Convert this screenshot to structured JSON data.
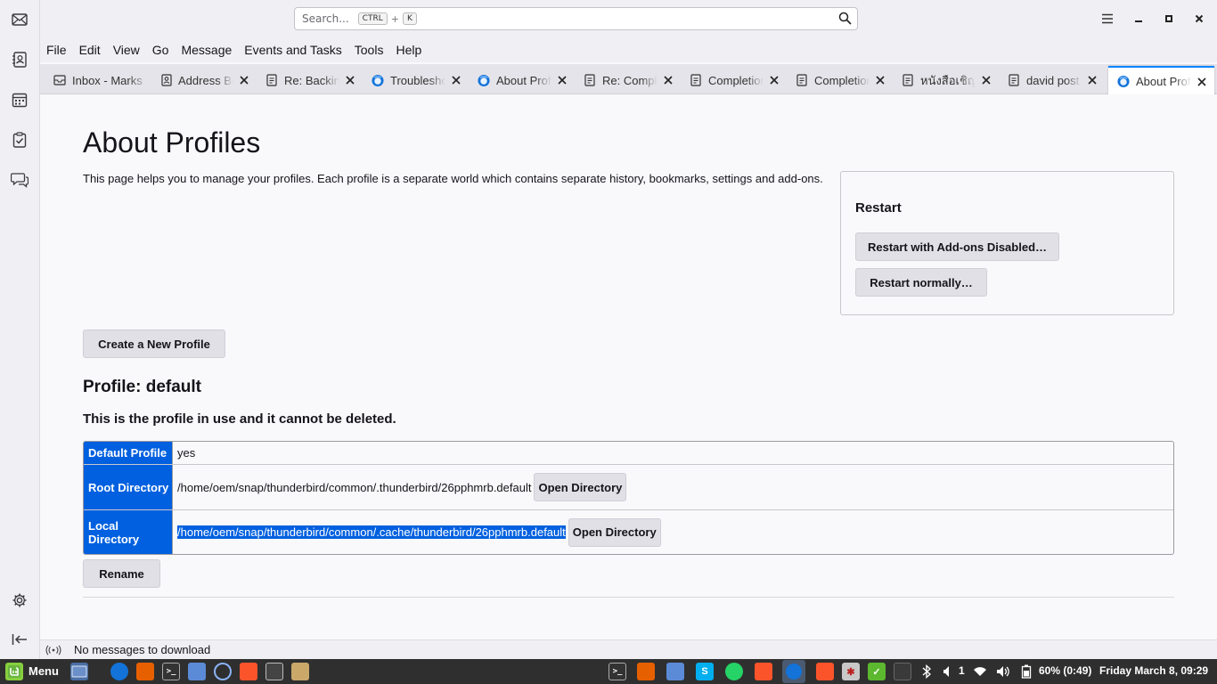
{
  "search": {
    "placeholder": "Search...",
    "shortcut_mod": "CTRL",
    "shortcut_plus": "+",
    "shortcut_key": "K"
  },
  "menubar": [
    "File",
    "Edit",
    "View",
    "Go",
    "Message",
    "Events and Tasks",
    "Tools",
    "Help"
  ],
  "tabs": [
    {
      "label": "Inbox - Marks",
      "icon": "mail-icon"
    },
    {
      "label": "Address Book",
      "icon": "address-book-icon"
    },
    {
      "label": "Re: Backing up",
      "icon": "message-icon"
    },
    {
      "label": "Troubleshooting",
      "icon": "thunderbird-icon"
    },
    {
      "label": "About Profiles",
      "icon": "thunderbird-icon"
    },
    {
      "label": "Re: Completion",
      "icon": "message-icon"
    },
    {
      "label": "Completion",
      "icon": "message-icon"
    },
    {
      "label": "Completion",
      "icon": "message-icon"
    },
    {
      "label": "หนังสือเชิญ",
      "icon": "message-icon"
    },
    {
      "label": "david post",
      "icon": "message-icon"
    },
    {
      "label": "About Profiles",
      "icon": "thunderbird-icon",
      "active": true
    }
  ],
  "page": {
    "title": "About Profiles",
    "intro": "This page helps you to manage your profiles. Each profile is a separate world which contains separate history, bookmarks, settings and add-ons.",
    "restart_heading": "Restart",
    "restart_addons_disabled": "Restart with Add-ons Disabled…",
    "restart_normally": "Restart normally…",
    "create_profile": "Create a New Profile",
    "profile_heading": "Profile: default",
    "profile_note": "This is the profile in use and it cannot be deleted.",
    "rows": {
      "default_label": "Default Profile",
      "default_value": "yes",
      "root_label": "Root Directory",
      "root_value": "/home/oem/snap/thunderbird/common/.thunderbird/26pphmrb.default",
      "local_label": "Local Directory",
      "local_value": "/home/oem/snap/thunderbird/common/.cache/thunderbird/26pphmrb.default",
      "open_directory": "Open Directory"
    },
    "rename": "Rename"
  },
  "status": {
    "text": "No messages to download"
  },
  "taskbar": {
    "menu": "Menu",
    "workspace": "1",
    "battery": "60% (0:49)",
    "clock": "Friday March  8, 09:29"
  },
  "colors": {
    "accent": "#0060df",
    "tab_active_border": "#0a84ff",
    "taskbar_bg": "#2f2f2f"
  }
}
